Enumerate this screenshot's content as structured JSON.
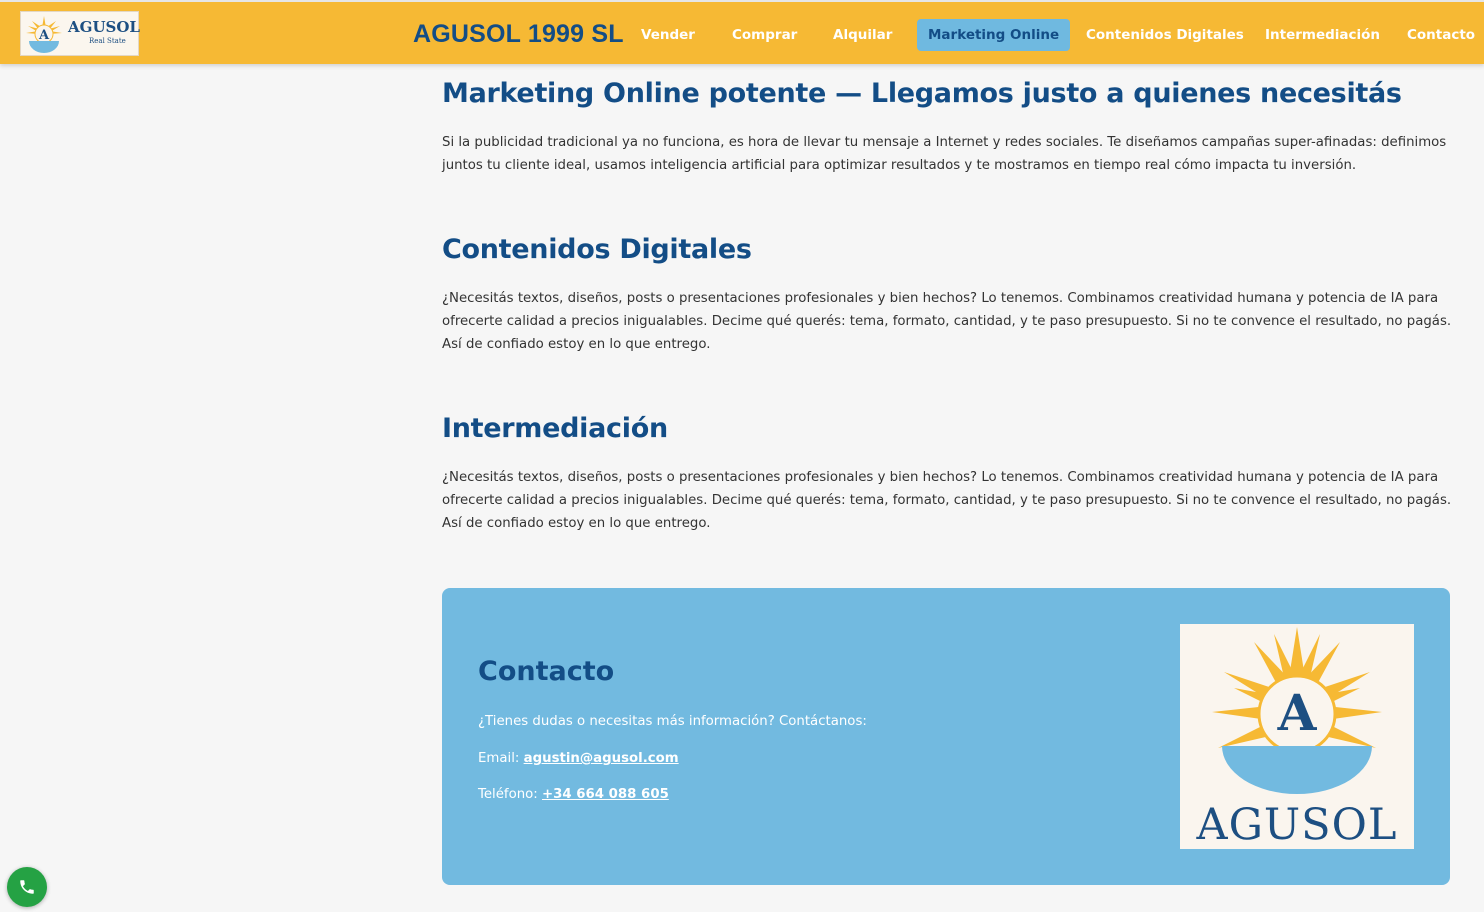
{
  "header": {
    "logo_name": "AGUSOL",
    "logo_sub": "Real State",
    "brand": "AGUSOL 1999 SL",
    "nav": [
      {
        "label": "Vender"
      },
      {
        "label": "Comprar"
      },
      {
        "label": "Alquilar"
      },
      {
        "label": "Marketing Online",
        "active": true
      },
      {
        "label": "Contenidos Digitales"
      },
      {
        "label": "Intermediación"
      },
      {
        "label": "Contacto"
      }
    ]
  },
  "sections": [
    {
      "title": "Marketing Online potente — Llegamos justo a quienes necesitás",
      "text": "Si la publicidad tradicional ya no funciona, es hora de llevar tu mensaje a Internet y redes sociales. Te diseñamos campañas super-afinadas: definimos juntos tu cliente ideal, usamos inteligencia artificial para optimizar resultados y te mostramos en tiempo real cómo impacta tu inversión."
    },
    {
      "title": "Contenidos Digitales",
      "text": "¿Necesitás textos, diseños, posts o presentaciones profesionales y bien hechos? Lo tenemos. Combinamos creatividad humana y potencia de IA para ofrecerte calidad a precios inigualables. Decime qué querés: tema, formato, cantidad, y te paso presupuesto. Si no te convence el resultado, no pagás. Así de confiado estoy en lo que entrego."
    },
    {
      "title": "Intermediación",
      "text": "¿Necesitás textos, diseños, posts o presentaciones profesionales y bien hechos? Lo tenemos. Combinamos creatividad humana y potencia de IA para ofrecerte calidad a precios inigualables. Decime qué querés: tema, formato, cantidad, y te paso presupuesto. Si no te convence el resultado, no pagás. Así de confiado estoy en lo que entrego."
    }
  ],
  "contact": {
    "title": "Contacto",
    "intro": "¿Tienes dudas o necesitas más información? Contáctanos:",
    "email_label": "Email:",
    "email": "agustin@agusol.com",
    "phone_label": "Teléfono:",
    "phone": "+34 664 088 605",
    "logo_name": "AGUSOL"
  },
  "floating": {
    "call_icon": "phone-icon"
  },
  "colors": {
    "header_bg": "#f6b934",
    "primary_blue": "#134d86",
    "accent_light_blue": "#72bae0",
    "call_green": "#25a244"
  }
}
